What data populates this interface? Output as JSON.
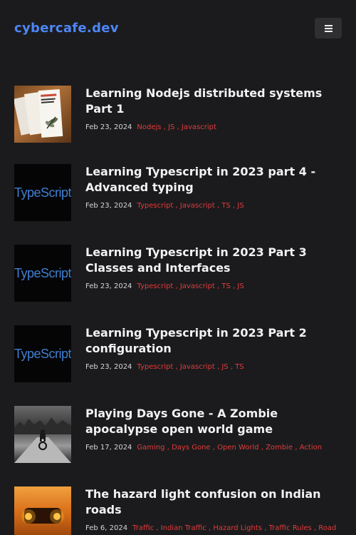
{
  "header": {
    "logo": "cybercafe.dev",
    "menu_icon": "hamburger-icon"
  },
  "posts": [
    {
      "title": "Learning Nodejs distributed systems Part 1",
      "date": "Feb 23, 2024",
      "tags": [
        "Nodejs",
        "JS",
        "Javascript"
      ],
      "thumbnail": "book-cover-image"
    },
    {
      "title": "Learning Typescript in 2023 part 4 - Advanced typing",
      "date": "Feb 23, 2024",
      "tags": [
        "Typescript",
        "Javascript",
        "TS",
        "JS"
      ],
      "thumbnail": "typescript-logo",
      "thumb_text": "TypeScript"
    },
    {
      "title": "Learning Typescript in 2023 Part 3 Classes and Interfaces",
      "date": "Feb 23, 2024",
      "tags": [
        "Typescript",
        "Javascript",
        "TS",
        "JS"
      ],
      "thumbnail": "typescript-logo",
      "thumb_text": "TypeScript"
    },
    {
      "title": "Learning Typescript in 2023 Part 2 configuration",
      "date": "Feb 23, 2024",
      "tags": [
        "Typescript",
        "Javascript",
        "JS",
        "TS"
      ],
      "thumbnail": "typescript-logo",
      "thumb_text": "TypeScript"
    },
    {
      "title": "Playing Days Gone - A Zombie apocalypse open world game",
      "date": "Feb 17, 2024",
      "tags": [
        "Gaming",
        "Days Gone",
        "Open World",
        "Zombie",
        "Action"
      ],
      "thumbnail": "motorcycle-image"
    },
    {
      "title": "The hazard light confusion on Indian roads",
      "date": "Feb 6, 2024",
      "tags": [
        "Traffic",
        "Indian Traffic",
        "Hazard Lights",
        "Traffic Rules",
        "Road"
      ],
      "thumbnail": "car-hazard-lights-image"
    }
  ],
  "colors": {
    "background": "#1b1b1d",
    "logo": "#4d86f5",
    "tag": "#e23b3b",
    "title": "#f2f2f3"
  }
}
